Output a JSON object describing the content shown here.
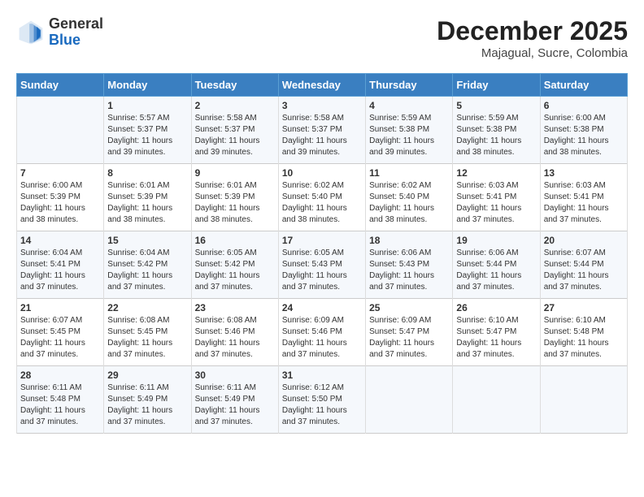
{
  "header": {
    "logo_general": "General",
    "logo_blue": "Blue",
    "month_year": "December 2025",
    "location": "Majagual, Sucre, Colombia"
  },
  "days_of_week": [
    "Sunday",
    "Monday",
    "Tuesday",
    "Wednesday",
    "Thursday",
    "Friday",
    "Saturday"
  ],
  "weeks": [
    [
      {
        "day": "",
        "info": ""
      },
      {
        "day": "1",
        "info": "Sunrise: 5:57 AM\nSunset: 5:37 PM\nDaylight: 11 hours and 39 minutes."
      },
      {
        "day": "2",
        "info": "Sunrise: 5:58 AM\nSunset: 5:37 PM\nDaylight: 11 hours and 39 minutes."
      },
      {
        "day": "3",
        "info": "Sunrise: 5:58 AM\nSunset: 5:37 PM\nDaylight: 11 hours and 39 minutes."
      },
      {
        "day": "4",
        "info": "Sunrise: 5:59 AM\nSunset: 5:38 PM\nDaylight: 11 hours and 39 minutes."
      },
      {
        "day": "5",
        "info": "Sunrise: 5:59 AM\nSunset: 5:38 PM\nDaylight: 11 hours and 38 minutes."
      },
      {
        "day": "6",
        "info": "Sunrise: 6:00 AM\nSunset: 5:38 PM\nDaylight: 11 hours and 38 minutes."
      }
    ],
    [
      {
        "day": "7",
        "info": "Sunrise: 6:00 AM\nSunset: 5:39 PM\nDaylight: 11 hours and 38 minutes."
      },
      {
        "day": "8",
        "info": "Sunrise: 6:01 AM\nSunset: 5:39 PM\nDaylight: 11 hours and 38 minutes."
      },
      {
        "day": "9",
        "info": "Sunrise: 6:01 AM\nSunset: 5:39 PM\nDaylight: 11 hours and 38 minutes."
      },
      {
        "day": "10",
        "info": "Sunrise: 6:02 AM\nSunset: 5:40 PM\nDaylight: 11 hours and 38 minutes."
      },
      {
        "day": "11",
        "info": "Sunrise: 6:02 AM\nSunset: 5:40 PM\nDaylight: 11 hours and 38 minutes."
      },
      {
        "day": "12",
        "info": "Sunrise: 6:03 AM\nSunset: 5:41 PM\nDaylight: 11 hours and 37 minutes."
      },
      {
        "day": "13",
        "info": "Sunrise: 6:03 AM\nSunset: 5:41 PM\nDaylight: 11 hours and 37 minutes."
      }
    ],
    [
      {
        "day": "14",
        "info": "Sunrise: 6:04 AM\nSunset: 5:41 PM\nDaylight: 11 hours and 37 minutes."
      },
      {
        "day": "15",
        "info": "Sunrise: 6:04 AM\nSunset: 5:42 PM\nDaylight: 11 hours and 37 minutes."
      },
      {
        "day": "16",
        "info": "Sunrise: 6:05 AM\nSunset: 5:42 PM\nDaylight: 11 hours and 37 minutes."
      },
      {
        "day": "17",
        "info": "Sunrise: 6:05 AM\nSunset: 5:43 PM\nDaylight: 11 hours and 37 minutes."
      },
      {
        "day": "18",
        "info": "Sunrise: 6:06 AM\nSunset: 5:43 PM\nDaylight: 11 hours and 37 minutes."
      },
      {
        "day": "19",
        "info": "Sunrise: 6:06 AM\nSunset: 5:44 PM\nDaylight: 11 hours and 37 minutes."
      },
      {
        "day": "20",
        "info": "Sunrise: 6:07 AM\nSunset: 5:44 PM\nDaylight: 11 hours and 37 minutes."
      }
    ],
    [
      {
        "day": "21",
        "info": "Sunrise: 6:07 AM\nSunset: 5:45 PM\nDaylight: 11 hours and 37 minutes."
      },
      {
        "day": "22",
        "info": "Sunrise: 6:08 AM\nSunset: 5:45 PM\nDaylight: 11 hours and 37 minutes."
      },
      {
        "day": "23",
        "info": "Sunrise: 6:08 AM\nSunset: 5:46 PM\nDaylight: 11 hours and 37 minutes."
      },
      {
        "day": "24",
        "info": "Sunrise: 6:09 AM\nSunset: 5:46 PM\nDaylight: 11 hours and 37 minutes."
      },
      {
        "day": "25",
        "info": "Sunrise: 6:09 AM\nSunset: 5:47 PM\nDaylight: 11 hours and 37 minutes."
      },
      {
        "day": "26",
        "info": "Sunrise: 6:10 AM\nSunset: 5:47 PM\nDaylight: 11 hours and 37 minutes."
      },
      {
        "day": "27",
        "info": "Sunrise: 6:10 AM\nSunset: 5:48 PM\nDaylight: 11 hours and 37 minutes."
      }
    ],
    [
      {
        "day": "28",
        "info": "Sunrise: 6:11 AM\nSunset: 5:48 PM\nDaylight: 11 hours and 37 minutes."
      },
      {
        "day": "29",
        "info": "Sunrise: 6:11 AM\nSunset: 5:49 PM\nDaylight: 11 hours and 37 minutes."
      },
      {
        "day": "30",
        "info": "Sunrise: 6:11 AM\nSunset: 5:49 PM\nDaylight: 11 hours and 37 minutes."
      },
      {
        "day": "31",
        "info": "Sunrise: 6:12 AM\nSunset: 5:50 PM\nDaylight: 11 hours and 37 minutes."
      },
      {
        "day": "",
        "info": ""
      },
      {
        "day": "",
        "info": ""
      },
      {
        "day": "",
        "info": ""
      }
    ]
  ]
}
